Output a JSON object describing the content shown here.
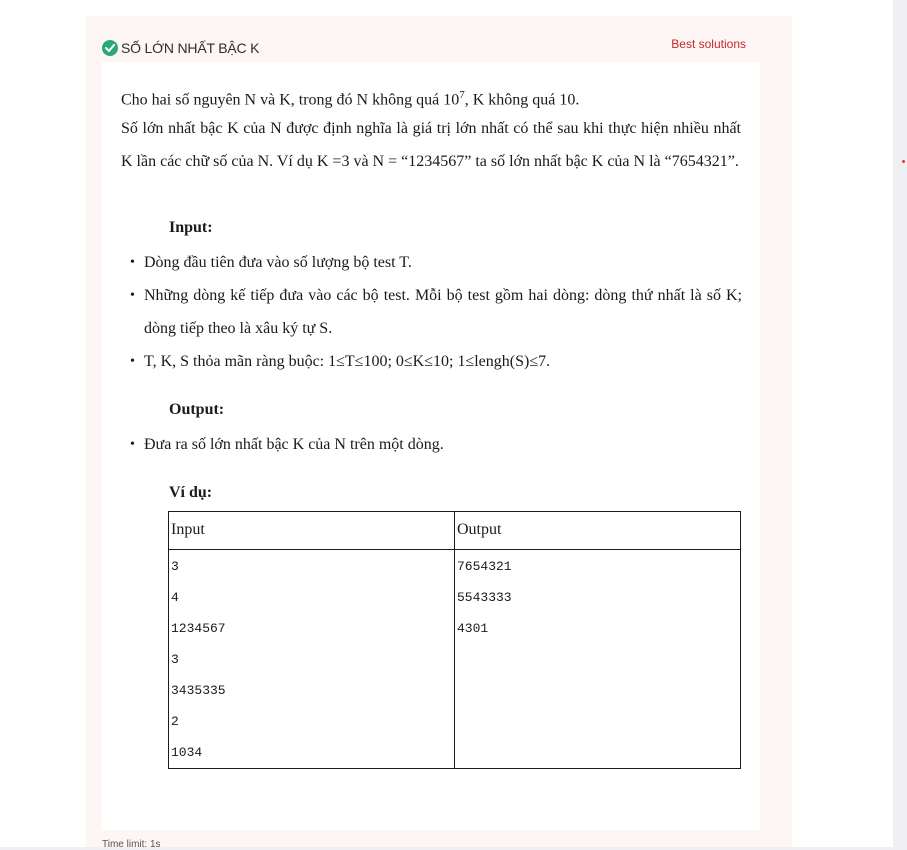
{
  "header": {
    "title": "SỐ LỚN NHẤT BẬC K",
    "best_solutions": "Best solutions"
  },
  "statement": {
    "p1_a": "Cho hai số nguyên N và K, trong đó N không quá 10",
    "p1_sup": "7",
    "p1_b": ", K không quá 10.",
    "p2": "Số lớn nhất bậc K của N được định nghĩa là giá trị lớn nhất có thể sau khi thực hiện nhiều nhất K lần các chữ số của N. Ví dụ K =3 và N = “1234567” ta số lớn nhất bậc K của N là “7654321”."
  },
  "input_section": {
    "title": "Input:",
    "bullets": [
      "Dòng đầu tiên đưa vào số lượng bộ test T.",
      "Những dòng kế tiếp đưa vào các bộ test. Mỗi bộ test gồm hai dòng: dòng thứ nhất là số K; dòng tiếp theo là xâu ký tự S.",
      "T, K, S thỏa mãn ràng buộc: 1≤T≤100; 0≤K≤10; 1≤lengh(S)≤7."
    ]
  },
  "output_section": {
    "title": "Output:",
    "bullets": [
      "Đưa ra số lớn nhất bậc K của N trên một dòng."
    ]
  },
  "example": {
    "title": "Ví dụ:",
    "header_input": "Input",
    "header_output": "Output",
    "input_lines": [
      "3",
      "4",
      "1234567",
      "3",
      "3435335",
      "2",
      "1034"
    ],
    "output_lines": [
      "7654321",
      "5543333",
      "4301"
    ]
  },
  "footer": {
    "time_limit": "Time limit: 1s"
  },
  "colors": {
    "accent_green": "#2aa876",
    "link_red": "#c62828"
  },
  "icons": {
    "status": "check-circle-icon"
  }
}
